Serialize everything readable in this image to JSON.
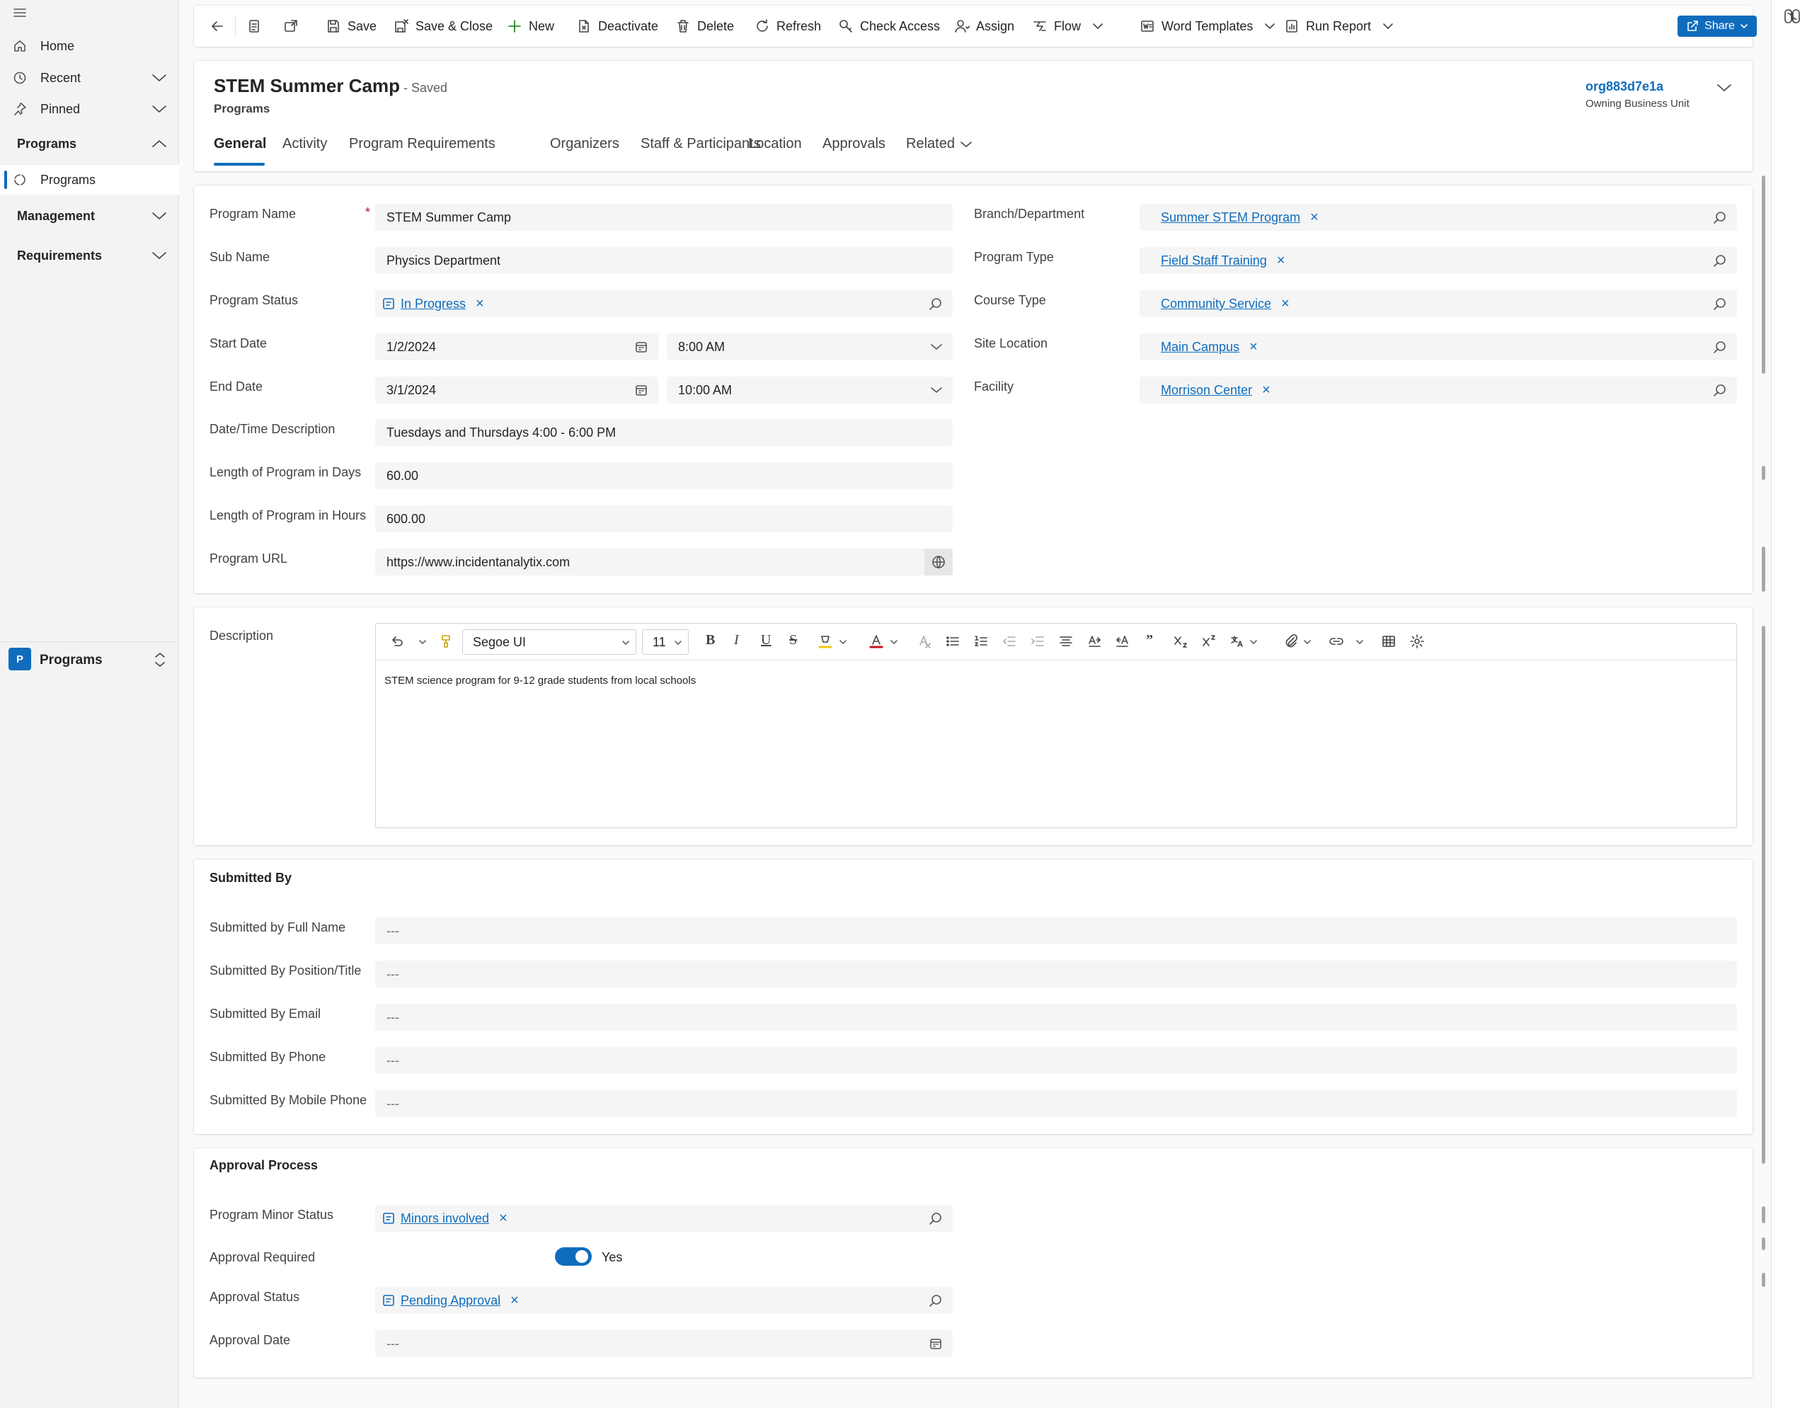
{
  "nav": {
    "items": [
      {
        "label": "Home",
        "icon": "home-icon"
      },
      {
        "label": "Recent",
        "icon": "clock-icon"
      },
      {
        "label": "Pinned",
        "icon": "pin-icon"
      }
    ],
    "groups": {
      "programs": {
        "title": "Programs",
        "items": [
          {
            "label": "Programs",
            "icon": "entity-icon"
          }
        ]
      },
      "management": {
        "title": "Management"
      },
      "requirements": {
        "title": "Requirements"
      }
    },
    "area": {
      "badge": "P",
      "label": "Programs"
    }
  },
  "commands": {
    "save": "Save",
    "save_close": "Save & Close",
    "new": "New",
    "deactivate": "Deactivate",
    "delete": "Delete",
    "refresh": "Refresh",
    "check_access": "Check Access",
    "assign": "Assign",
    "flow": "Flow",
    "word_templates": "Word Templates",
    "run_report": "Run Report",
    "share": "Share"
  },
  "record": {
    "title": "STEM Summer Camp",
    "saved_status": "- Saved",
    "entity": "Programs",
    "owner": "org883d7e1a",
    "owner_label": "Owning Business Unit"
  },
  "tabs": [
    "General",
    "Activity",
    "Program Requirements",
    "Organizers",
    "Staff & Participants",
    "Location",
    "Approvals",
    "Related"
  ],
  "general": {
    "labels": {
      "program_name": "Program Name",
      "sub_name": "Sub Name",
      "program_status": "Program Status",
      "start_date": "Start Date",
      "end_date": "End Date",
      "datetime_description": "Date/Time Description",
      "length_days": "Length of Program in Days",
      "length_hours": "Length of Program in Hours",
      "program_url": "Program URL",
      "branch_department": "Branch/Department",
      "program_type": "Program Type",
      "course_type": "Course Type",
      "site_location": "Site Location",
      "facility": "Facility"
    },
    "values": {
      "required_marker": "*",
      "program_name": "STEM Summer Camp",
      "sub_name": "Physics Department",
      "program_status": "In Progress",
      "start_date": "1/2/2024",
      "start_time": "8:00 AM",
      "end_date": "3/1/2024",
      "end_time": "10:00 AM",
      "datetime_description": "Tuesdays and Thursdays 4:00 - 6:00 PM",
      "length_days": "60.00",
      "length_hours": "600.00",
      "program_url": "https://www.incidentanalytix.com",
      "branch_department": "Summer STEM Program",
      "program_type": "Field Staff Training",
      "course_type": "Community Service",
      "site_location": "Main Campus",
      "facility": "Morrison Center"
    }
  },
  "description": {
    "label": "Description",
    "font": "Segoe UI",
    "font_size": "11",
    "text": "STEM science program for 9-12 grade students from local schools"
  },
  "submitted_by": {
    "title": "Submitted By",
    "empty": "---",
    "labels": {
      "full_name": "Submitted by Full Name",
      "position": "Submitted By Position/Title",
      "email": "Submitted By Email",
      "phone": "Submitted By Phone",
      "mobile": "Submitted By Mobile Phone"
    }
  },
  "approval": {
    "title": "Approval Process",
    "labels": {
      "minor_status": "Program Minor Status",
      "approval_required": "Approval Required",
      "approval_status": "Approval Status",
      "approval_date": "Approval Date"
    },
    "values": {
      "minor_status": "Minors involved",
      "approval_required": "Yes",
      "approval_status": "Pending Approval",
      "approval_date": "---"
    }
  },
  "colors": {
    "accent": "#0f6cbd",
    "required": "#c50f1f"
  }
}
